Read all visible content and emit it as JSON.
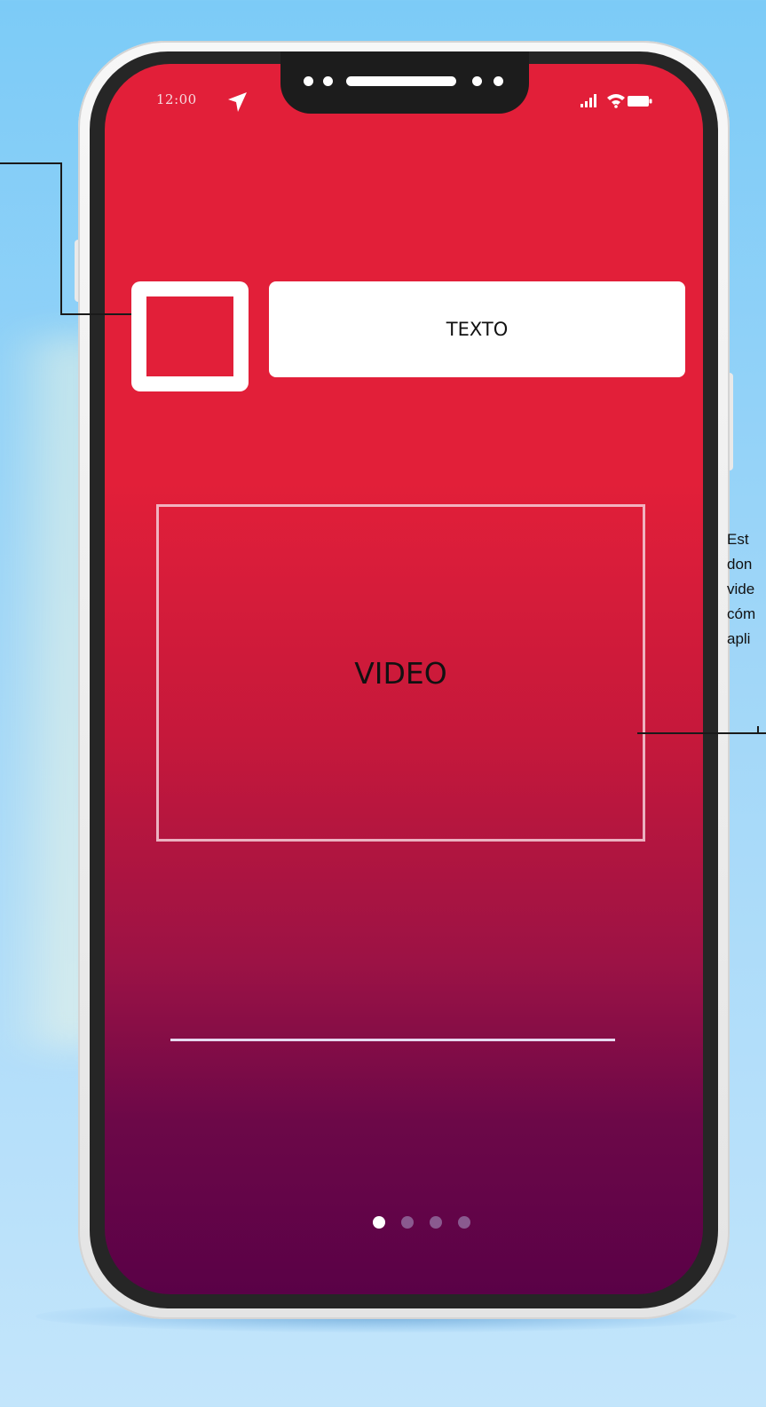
{
  "status_bar": {
    "time": "12:00",
    "location_icon": "location-arrow-icon",
    "signal_icon": "cellular-signal-icon",
    "wifi_icon": "wifi-icon",
    "battery_icon": "battery-icon"
  },
  "header": {
    "icon_placeholder": "app-icon-placeholder",
    "text_label": "TEXTO"
  },
  "video": {
    "label": "VIDEO"
  },
  "annotation": {
    "text": "Est\ndon\nvide\ncóm\napli"
  },
  "pagination": {
    "total": 4,
    "active_index": 0
  },
  "colors": {
    "background": "#7ccbf7",
    "screen_top": "#e21f39",
    "screen_bottom": "#5a0147",
    "frame": "#f2f2f2",
    "bezel": "#262626"
  }
}
